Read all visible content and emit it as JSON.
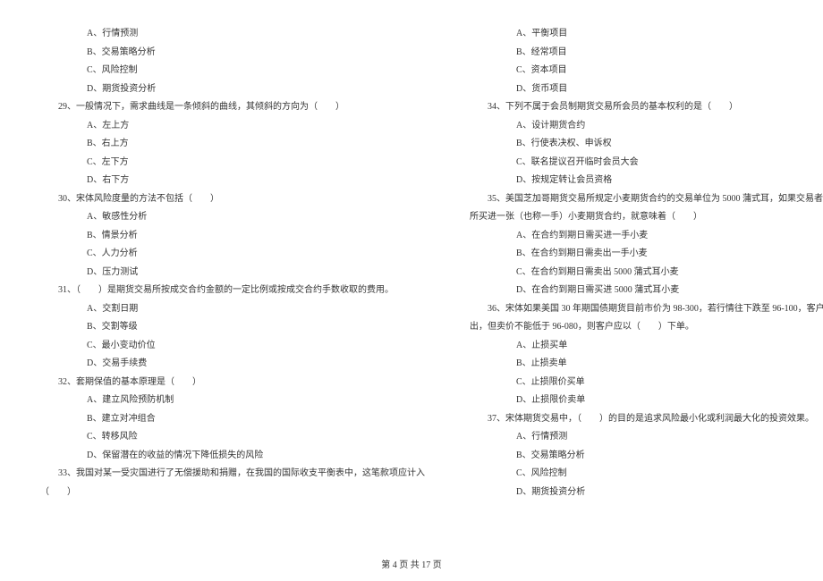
{
  "left_column": {
    "q28_options": {
      "a": "A、行情预测",
      "b": "B、交易策略分析",
      "c": "C、风险控制",
      "d": "D、期货投资分析"
    },
    "q29": {
      "text": "29、一般情况下，需求曲线是一条倾斜的曲线，其倾斜的方向为（　　）",
      "a": "A、左上方",
      "b": "B、右上方",
      "c": "C、左下方",
      "d": "D、右下方"
    },
    "q30": {
      "text": "30、宋体风险度量的方法不包括（　　）",
      "a": "A、敏感性分析",
      "b": "B、情景分析",
      "c": "C、人力分析",
      "d": "D、压力测试"
    },
    "q31": {
      "text": "31、（　　）是期货交易所按成交合约金额的一定比例或按成交合约手数收取的费用。",
      "a": "A、交割日期",
      "b": "B、交割等级",
      "c": "C、最小变动价位",
      "d": "D、交易手续费"
    },
    "q32": {
      "text": "32、套期保值的基本原理是（　　）",
      "a": "A、建立风险预防机制",
      "b": "B、建立对冲组合",
      "c": "C、转移风险",
      "d": "D、保留潜在的收益的情况下降低损失的风险"
    },
    "q33": {
      "text": "33、我国对某一受灾国进行了无偿援助和捐赠，在我国的国际收支平衡表中，这笔款项应计入",
      "blank": "（　　）"
    }
  },
  "right_column": {
    "q33_options": {
      "a": "A、平衡项目",
      "b": "B、经常项目",
      "c": "C、资本项目",
      "d": "D、货币项目"
    },
    "q34": {
      "text": "34、下列不属于会员制期货交易所会员的基本权利的是（　　）",
      "a": "A、设计期货合约",
      "b": "B、行使表决权、申诉权",
      "c": "C、联名提议召开临时会员大会",
      "d": "D、按规定转让会员资格"
    },
    "q35": {
      "text": "35、美国芝加哥期货交易所规定小麦期货合约的交易单位为 5000 蒲式耳，如果交易者在该交易",
      "text2": "所买进一张（也称一手）小麦期货合约，就意味着（　　）",
      "a": "A、在合约到期日需买进一手小麦",
      "b": "B、在合约到期日需卖出一手小麦",
      "c": "C、在合约到期日需卖出 5000 蒲式耳小麦",
      "d": "D、在合约到期日需买进 5000 蒲式耳小麦"
    },
    "q36": {
      "text": "36、宋体如果美国 30 年期国债期货目前市价为 98-300，若行情往下跌至 96-100，客户就想卖",
      "text2": "出，但卖价不能低于 96-080，则客户应以（　　）下单。",
      "a": "A、止损买单",
      "b": "B、止损卖单",
      "c": "C、止损限价买单",
      "d": "D、止损限价卖单"
    },
    "q37": {
      "text": "37、宋体期货交易中，（　　）的目的是追求风险最小化或利润最大化的投资效果。",
      "a": "A、行情预测",
      "b": "B、交易策略分析",
      "c": "C、风险控制",
      "d": "D、期货投资分析"
    }
  },
  "footer": "第 4 页 共 17 页"
}
